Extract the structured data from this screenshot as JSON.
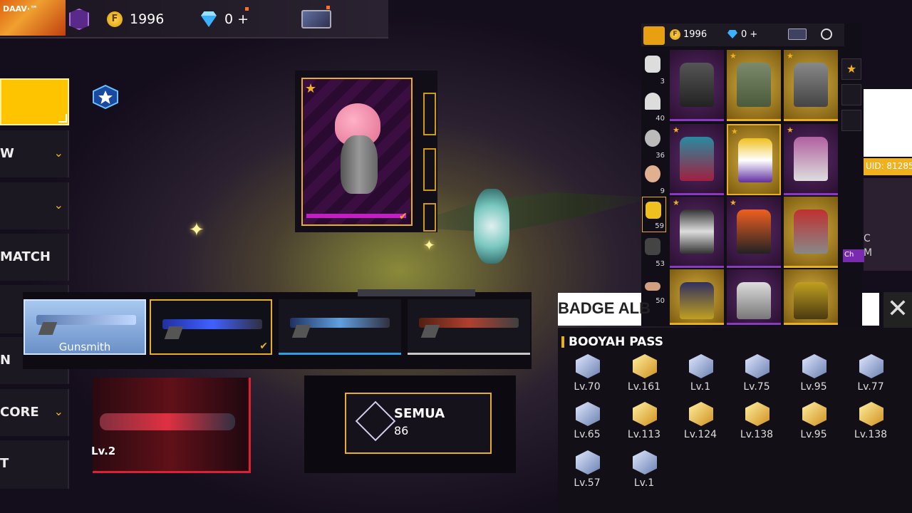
{
  "top_bar": {
    "player_name": "DAAV·™",
    "coin_symbol": "F",
    "coins": "1996",
    "diamonds": "0 +"
  },
  "left_menu": {
    "items": [
      {
        "label": "W"
      },
      {
        "label": ""
      },
      {
        "label": "MATCH"
      },
      {
        "label": ""
      },
      {
        "label": "N"
      },
      {
        "label": "CORE"
      },
      {
        "label": "T"
      }
    ]
  },
  "weapons": {
    "items": [
      {
        "label": "Gunsmith"
      },
      {
        "label": ""
      },
      {
        "label": ""
      },
      {
        "label": ""
      }
    ]
  },
  "bottom_weapon": {
    "level": "Lv.2"
  },
  "collection": {
    "title": "SEMUA",
    "count": "86"
  },
  "costume_panel": {
    "coin_symbol": "F",
    "coins": "1996",
    "diamonds": "0 +",
    "categories": [
      {
        "icon": "shirt-icon",
        "count": "3"
      },
      {
        "icon": "cap-icon",
        "count": "40"
      },
      {
        "icon": "mask-icon",
        "count": "36"
      },
      {
        "icon": "face-icon",
        "count": "9"
      },
      {
        "icon": "top-icon",
        "count": "59"
      },
      {
        "icon": "pants-icon",
        "count": "53"
      },
      {
        "icon": "shoes-icon",
        "count": "50"
      }
    ]
  },
  "badge_album": {
    "title": "BADGE ALB",
    "section": "BOOYAH PASS",
    "badges": [
      {
        "level": "Lv.70"
      },
      {
        "level": "Lv.161"
      },
      {
        "level": "Lv.1"
      },
      {
        "level": "Lv.75"
      },
      {
        "level": "Lv.95"
      },
      {
        "level": "Lv.77"
      },
      {
        "level": "Lv.65"
      },
      {
        "level": "Lv.113"
      },
      {
        "level": "Lv.124"
      },
      {
        "level": "Lv.138"
      },
      {
        "level": "Lv.95"
      },
      {
        "level": "Lv.138"
      },
      {
        "level": "Lv.57"
      },
      {
        "level": "Lv.1"
      }
    ]
  },
  "right_side": {
    "uid": "UID: 81285",
    "partial_text": "C\nM",
    "ch_label": "Ch"
  },
  "colors": {
    "accent": "#e8b020",
    "bg": "#140d1c"
  }
}
